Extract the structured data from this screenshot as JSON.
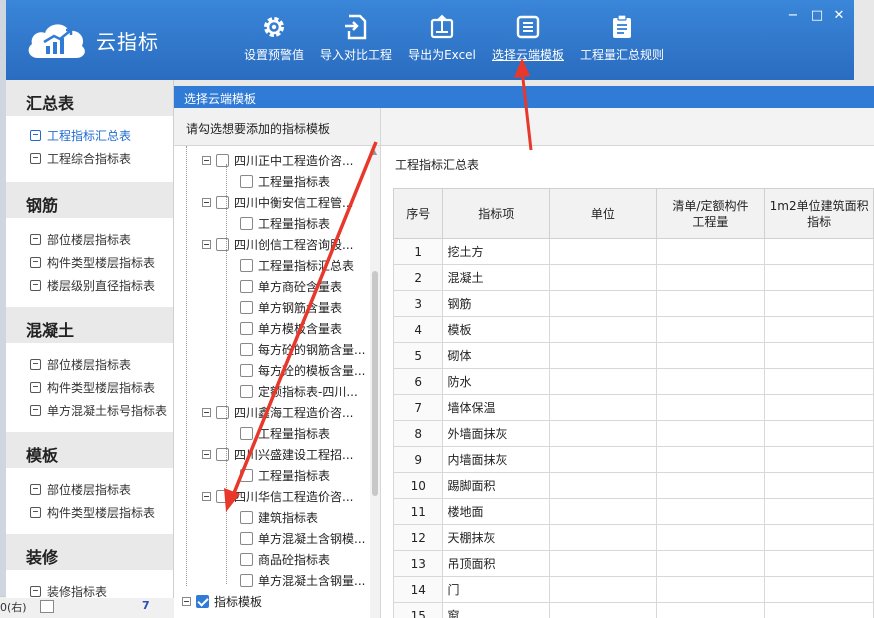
{
  "app": {
    "name": "云指标",
    "colors": {
      "toolbar": "#2f7bd6",
      "accent": "#1f6bd1",
      "arrow": "#e8382b"
    }
  },
  "toolbar": {
    "items": [
      {
        "label": "设置预警值",
        "icon": "gear-icon"
      },
      {
        "label": "导入对比工程",
        "icon": "import-icon"
      },
      {
        "label": "导出为Excel",
        "icon": "export-icon"
      },
      {
        "label": "选择云端模板",
        "icon": "template-icon"
      },
      {
        "label": "工程量汇总规则",
        "icon": "clipboard-icon"
      }
    ],
    "window_buttons": [
      "−",
      "□",
      "✕"
    ]
  },
  "nav": {
    "sections": [
      {
        "title": "汇总表",
        "items": [
          "工程指标汇总表",
          "工程综合指标表"
        ]
      },
      {
        "title": "钢筋",
        "items": [
          "部位楼层指标表",
          "构件类型楼层指标表",
          "楼层级别直径指标表"
        ]
      },
      {
        "title": "混凝土",
        "items": [
          "部位楼层指标表",
          "构件类型楼层指标表",
          "单方混凝土标号指标表"
        ]
      },
      {
        "title": "模板",
        "items": [
          "部位楼层指标表",
          "构件类型楼层指标表"
        ]
      },
      {
        "title": "装修",
        "items": [
          "装修指标表"
        ]
      }
    ]
  },
  "dialog": {
    "title": "选择云端模板",
    "instruction": "请勾选想要添加的指标模板",
    "tree": [
      {
        "label": "四川正中工程造价咨...",
        "level": 0,
        "checked": false
      },
      {
        "label": "工程量指标表",
        "level": 1,
        "checked": false
      },
      {
        "label": "四川中衡安信工程管...",
        "level": 0,
        "checked": false
      },
      {
        "label": "工程量指标表",
        "level": 1,
        "checked": false
      },
      {
        "label": "四川创信工程咨询股...",
        "level": 0,
        "checked": false
      },
      {
        "label": "工程量指标汇总表",
        "level": 1,
        "checked": false
      },
      {
        "label": "单方商砼含量表",
        "level": 1,
        "checked": false
      },
      {
        "label": "单方钢筋含量表",
        "level": 1,
        "checked": false
      },
      {
        "label": "单方模板含量表",
        "level": 1,
        "checked": false
      },
      {
        "label": "每方砼的钢筋含量...",
        "level": 1,
        "checked": false
      },
      {
        "label": "每方砼的模板含量...",
        "level": 1,
        "checked": false
      },
      {
        "label": "定额指标表-四川...",
        "level": 1,
        "checked": false
      },
      {
        "label": "四川鑫海工程造价咨...",
        "level": 0,
        "checked": false
      },
      {
        "label": "工程量指标表",
        "level": 1,
        "checked": false
      },
      {
        "label": "四川兴盛建设工程招...",
        "level": 0,
        "checked": false
      },
      {
        "label": "工程量指标表",
        "level": 1,
        "checked": false
      },
      {
        "label": "四川华信工程造价咨...",
        "level": 0,
        "checked": false
      },
      {
        "label": "建筑指标表",
        "level": 1,
        "checked": false
      },
      {
        "label": "单方混凝土含钢模...",
        "level": 1,
        "checked": false
      },
      {
        "label": "商品砼指标表",
        "level": 1,
        "checked": false
      },
      {
        "label": "单方混凝土含钢量...",
        "level": 1,
        "checked": false
      },
      {
        "label": "指标模板",
        "level": -1,
        "checked": true
      }
    ],
    "preview": {
      "title": "工程指标汇总表",
      "columns": [
        "序号",
        "指标项",
        "单位",
        "清单/定额构件\n工程量",
        "1m2单位建筑面积\n指标"
      ],
      "rows": [
        [
          "1",
          "挖土方"
        ],
        [
          "2",
          "混凝土"
        ],
        [
          "3",
          "钢筋"
        ],
        [
          "4",
          "模板"
        ],
        [
          "5",
          "砌体"
        ],
        [
          "6",
          "防水"
        ],
        [
          "7",
          "墙体保温"
        ],
        [
          "8",
          "外墙面抹灰"
        ],
        [
          "9",
          "内墙面抹灰"
        ],
        [
          "10",
          "踢脚面积"
        ],
        [
          "11",
          "楼地面"
        ],
        [
          "12",
          "天棚抹灰"
        ],
        [
          "13",
          "吊顶面积"
        ],
        [
          "14",
          "门"
        ],
        [
          "15",
          "窗"
        ]
      ]
    }
  },
  "background": {
    "bottom_left_text": "0(右)",
    "bottom_mid_text": "7"
  }
}
